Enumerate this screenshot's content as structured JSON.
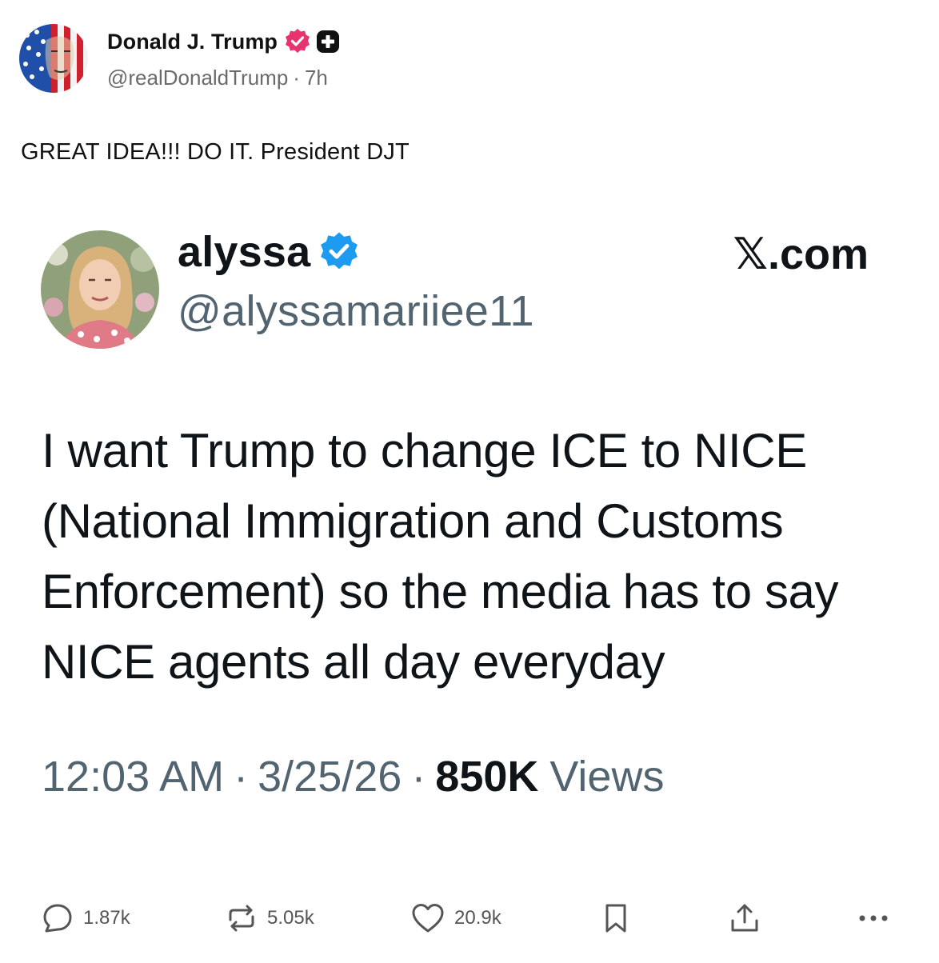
{
  "post": {
    "author_name": "Donald J. Trump",
    "handle": "@realDonaldTrump",
    "separator": "·",
    "time_ago": "7h",
    "text": "GREAT IDEA!!! DO IT. President DJT"
  },
  "embed": {
    "name": "alyssa",
    "handle": "@alyssamariiee11",
    "site_x": "𝕏",
    "site_suffix": ".com",
    "body": "I want Trump to change ICE to NICE (National Immigration and Customs Enforcement) so the media has to say NICE agents all day everyday",
    "time": "12:03 AM",
    "dot": "·",
    "date": "3/25/26",
    "views_count": "850K",
    "views_label": "Views"
  },
  "actions": {
    "replies": "1.87k",
    "reposts": "5.05k",
    "likes": "20.9k"
  },
  "colors": {
    "verified_badge": "#e8336f",
    "embed_verified_badge": "#1d9bf0",
    "secondary_text": "#6b6b6b"
  },
  "icons": {
    "verified": "verified-badge-icon",
    "plus": "plus-badge-icon",
    "reply": "reply-icon",
    "repost": "repost-icon",
    "like": "heart-icon",
    "bookmark": "bookmark-icon",
    "share": "share-icon",
    "more": "more-icon"
  }
}
